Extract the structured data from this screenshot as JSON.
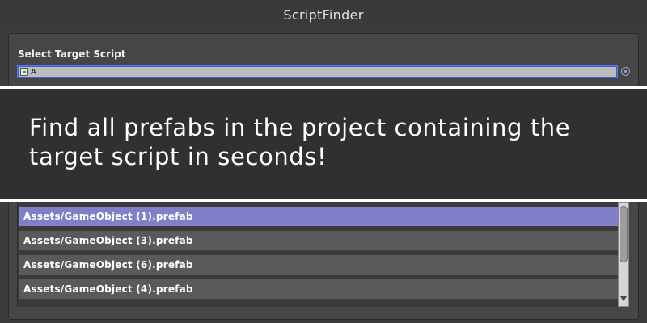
{
  "window": {
    "title": "ScriptFinder"
  },
  "target": {
    "label": "Select Target Script",
    "value": "A",
    "icon": "script-icon",
    "picker_icon": "object-picker-icon"
  },
  "banner": {
    "text": "Find all prefabs in the project containing the target script in seconds!"
  },
  "results": {
    "items": [
      {
        "path": "Assets/GameObject (1).prefab",
        "selected": true
      },
      {
        "path": "Assets/GameObject (3).prefab",
        "selected": false
      },
      {
        "path": "Assets/GameObject (6).prefab",
        "selected": false
      },
      {
        "path": "Assets/GameObject (4).prefab",
        "selected": false
      }
    ]
  },
  "colors": {
    "background": "#3c3c3c",
    "selection": "#8080c9",
    "row": "#5a5a5a",
    "field_focus": "#5a78e6",
    "banner": "#303030"
  }
}
